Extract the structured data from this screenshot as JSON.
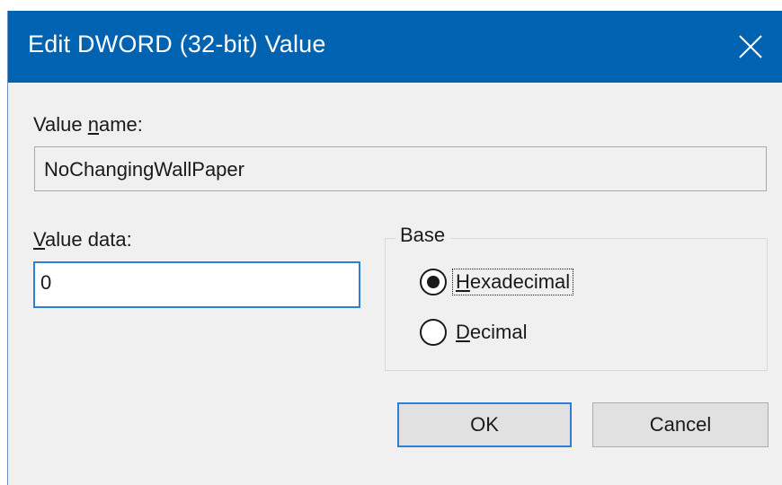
{
  "window": {
    "title": "Edit DWORD (32-bit) Value",
    "close_icon": "close-icon",
    "titlebar_color": "#0063b1"
  },
  "value_name": {
    "label_pre": "Value ",
    "label_mnemonic": "n",
    "label_post": "ame:",
    "value": "NoChangingWallPaper"
  },
  "value_data": {
    "label_mnemonic": "V",
    "label_post": "alue data:",
    "value": "0"
  },
  "base": {
    "legend": "Base",
    "options": [
      {
        "mnemonic": "H",
        "rest": "exadecimal",
        "selected": true
      },
      {
        "mnemonic": "D",
        "rest": "ecimal",
        "selected": false
      }
    ]
  },
  "buttons": {
    "ok_label": "OK",
    "cancel_label": "Cancel",
    "accent_color": "#2f7fd6"
  }
}
